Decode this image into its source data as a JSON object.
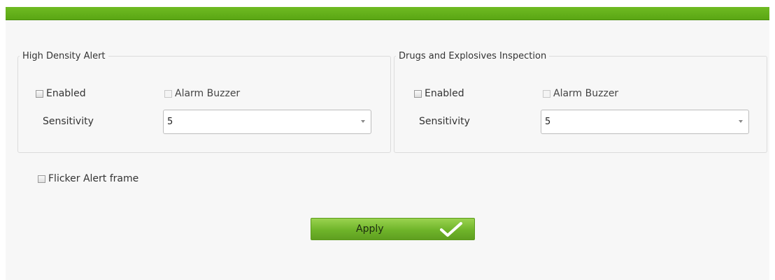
{
  "high_density_alert": {
    "title": "High Density Alert",
    "enabled_label": "Enabled",
    "alarm_buzzer_label": "Alarm Buzzer",
    "sensitivity_label": "Sensitivity",
    "sensitivity_value": "5"
  },
  "drugs_explosives": {
    "title": "Drugs and Explosives Inspection",
    "enabled_label": "Enabled",
    "alarm_buzzer_label": "Alarm Buzzer",
    "sensitivity_label": "Sensitivity",
    "sensitivity_value": "5"
  },
  "flicker_label": "Flicker Alert frame",
  "apply_label": "Apply",
  "icons": {
    "apply": "check-icon",
    "dropdown": "chevron-down-icon"
  },
  "colors": {
    "accent_green": "#6fbb22",
    "panel_bg": "#f7f7f7"
  }
}
